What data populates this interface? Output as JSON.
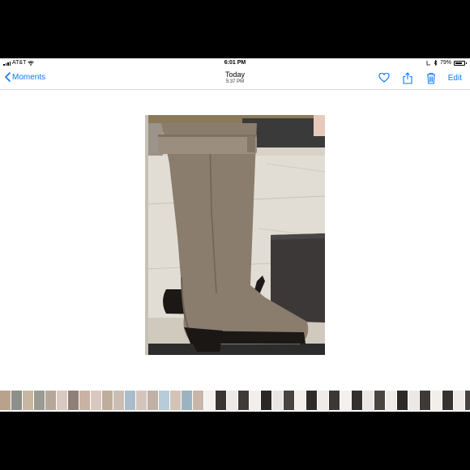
{
  "status_bar": {
    "carrier": "AT&T",
    "time": "6:01 PM",
    "battery": "79%",
    "battery_level": 0.79
  },
  "nav": {
    "back_label": "Moments",
    "title": "Today",
    "subtitle": "5:37 PM",
    "edit_label": "Edit"
  },
  "icons": {
    "back": "chevron-left-icon",
    "favorite": "heart-icon",
    "share": "share-icon",
    "delete": "trash-icon"
  },
  "colors": {
    "accent": "#0a7aff"
  },
  "filmstrip": {
    "thumbnails": [
      "#b9a28c",
      "#8d8f8a",
      "#c8b7a0",
      "#9a9a94",
      "#b5a89a",
      "#d9c9c0",
      "#8f7f74",
      "#c9b3a5",
      "#d8c8be",
      "#bfae9b",
      "#ccbdb2",
      "#a9bccc",
      "#d3c5bb",
      "#c0b0a6",
      "#b7cbd8",
      "#d4c2b6",
      "#9bb3c0",
      "#c8b6a8",
      "#f4f1ee",
      "#3a3532",
      "#ede9e6",
      "#403b38",
      "#f1eeeb",
      "#2c2826",
      "#e9e5e2",
      "#4a4440",
      "#f2efec",
      "#2f2b29",
      "#eeebe8",
      "#3c3734",
      "#f3f0ed",
      "#343030",
      "#ebe7e4",
      "#4b4542",
      "#f0ede9",
      "#2e2a27",
      "#ece8e5",
      "#3f3a36",
      "#f2efeb",
      "#37322f",
      "#efebe8",
      "#474240"
    ]
  }
}
